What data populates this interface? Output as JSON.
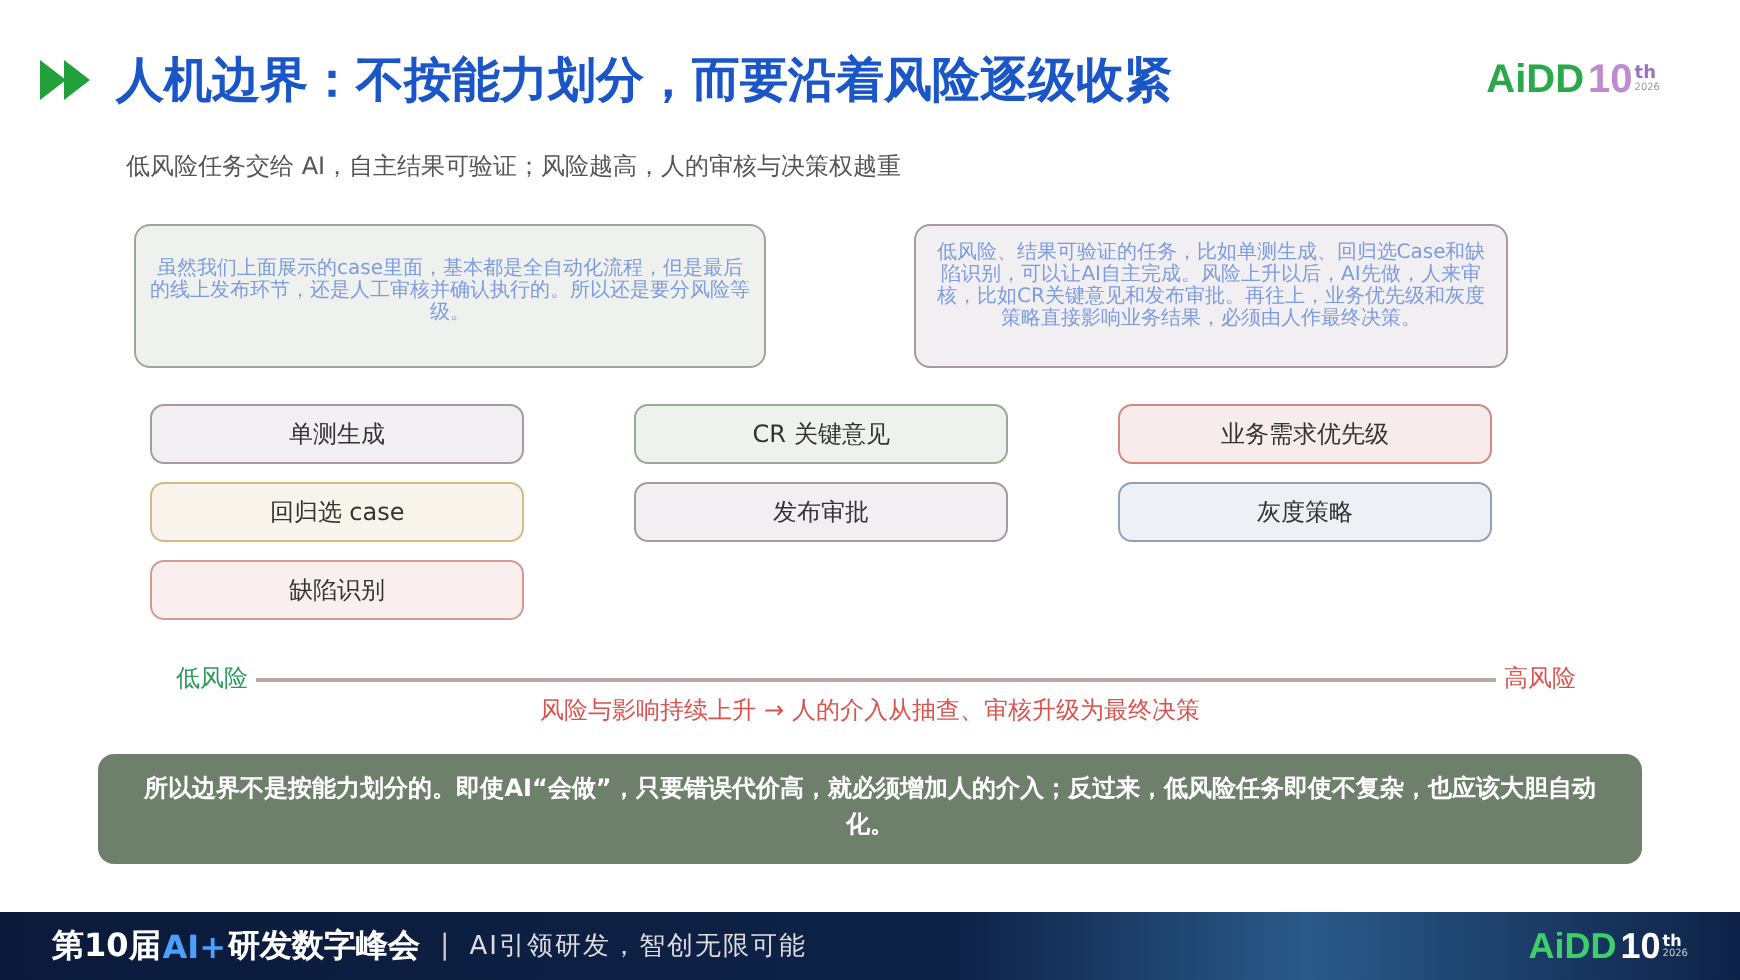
{
  "header": {
    "title": "人机边界：不按能力划分，而要沿着风险逐级收紧",
    "subtitle": "低风险任务交给 AI，自主结果可验证；风险越高，人的审核与决策权越重"
  },
  "logo": {
    "name": "AiDD",
    "number": "10",
    "suffix": "th",
    "year": "2026"
  },
  "notes": [
    {
      "text": "虽然我们上面展示的case里面，基本都是全自动化流程，但是最后的线上发布环节，还是人工审核并确认执行的。所以还是要分风险等级。",
      "color": "#9aa79a"
    },
    {
      "text": "低风险、结果可验证的任务，比如单测生成、回归选Case和缺陷识别，可以让AI自主完成。风险上升以后，AI先做，人来审核，比如CR关键意见和发布审批。再往上，业务优先级和灰度策略直接影响业务结果，必须由人作最终决策。",
      "color": "#a898a8"
    }
  ],
  "columns": [
    {
      "tags": [
        {
          "label": "单测生成",
          "color": "#a898a8"
        },
        {
          "label": "回归选 case",
          "color": "#d4b98a"
        },
        {
          "label": "缺陷识别",
          "color": "#d49b94"
        }
      ]
    },
    {
      "tags": [
        {
          "label": "CR 关键意见",
          "color": "#94ab94"
        },
        {
          "label": "发布审批",
          "color": "#a898a8"
        }
      ]
    },
    {
      "tags": [
        {
          "label": "业务需求优先级",
          "color": "#d08a80"
        },
        {
          "label": "灰度策略",
          "color": "#8fa3b8"
        }
      ]
    }
  ],
  "axis": {
    "low_label": "低风险",
    "high_label": "高风险",
    "caption": "风险与影响持续上升 → 人的介入从抽查、审核升级为最终决策"
  },
  "conclusion": "所以边界不是按能力划分的。即使AI“会做”，只要错误代价高，就必须增加人的介入；反过来，低风险任务即使不复杂，也应该大胆自动化。",
  "footer_logo": {
    "name": "AiDD",
    "number": "10",
    "suffix": "th",
    "year": "2026"
  },
  "footer": {
    "edition": "第10届",
    "brand": "AI+",
    "event": "研发数字峰会",
    "separator": "|",
    "slogan": "AI引领研发，智创无限可能"
  }
}
